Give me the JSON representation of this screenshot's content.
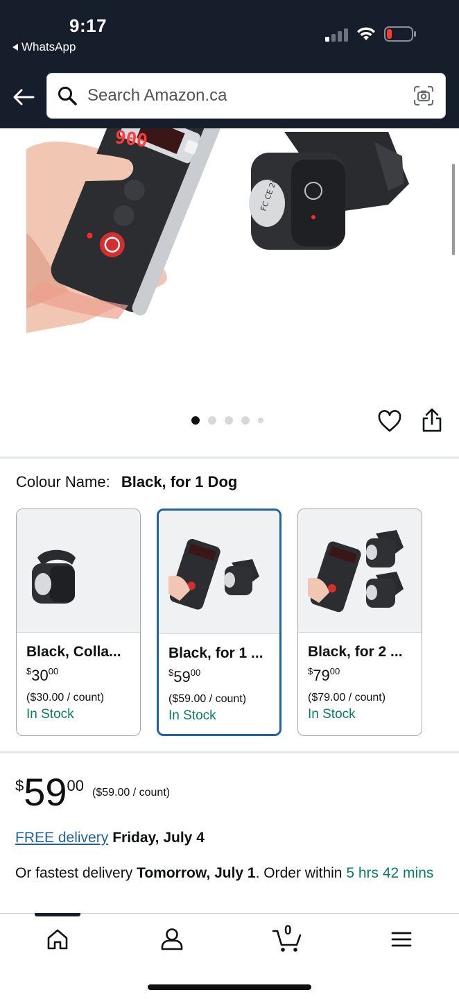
{
  "status_bar": {
    "time": "9:17",
    "back_app": "WhatsApp"
  },
  "header": {
    "search_placeholder": "Search Amazon.ca"
  },
  "product_image": {
    "display_text": "900",
    "current_image": 1,
    "total_images": 5
  },
  "colour": {
    "label": "Colour Name:",
    "selected_value": "Black, for 1 Dog"
  },
  "swatches": [
    {
      "name": "Black, Colla...",
      "price_symbol": "$",
      "price_whole": "30",
      "price_fraction": "00",
      "unit_price": "($30.00 / count)",
      "availability": "In Stock",
      "selected": false
    },
    {
      "name": "Black, for 1 ...",
      "price_symbol": "$",
      "price_whole": "59",
      "price_fraction": "00",
      "unit_price": "($59.00 / count)",
      "availability": "In Stock",
      "selected": true
    },
    {
      "name": "Black, for 2 ...",
      "price_symbol": "$",
      "price_whole": "79",
      "price_fraction": "00",
      "unit_price": "($79.00 / count)",
      "availability": "In Stock",
      "selected": false
    }
  ],
  "price": {
    "symbol": "$",
    "whole": "59",
    "fraction": "00",
    "per_unit": "($59.00 / count)"
  },
  "delivery": {
    "free_label": "FREE delivery",
    "free_date": "Friday, July 4",
    "fastest_prefix": "Or fastest delivery",
    "fastest_date": "Tomorrow, July 1",
    "order_within_prefix": ". Order within",
    "countdown": "5 hrs 42 mins"
  },
  "bottom_nav": {
    "cart_count": "0",
    "items": [
      "home-icon",
      "account-icon",
      "cart-icon",
      "menu-icon"
    ]
  },
  "colors": {
    "header_bg": "#161d2b",
    "link": "#2162a1",
    "in_stock": "#067d62",
    "selected_border": "#2162a1"
  }
}
